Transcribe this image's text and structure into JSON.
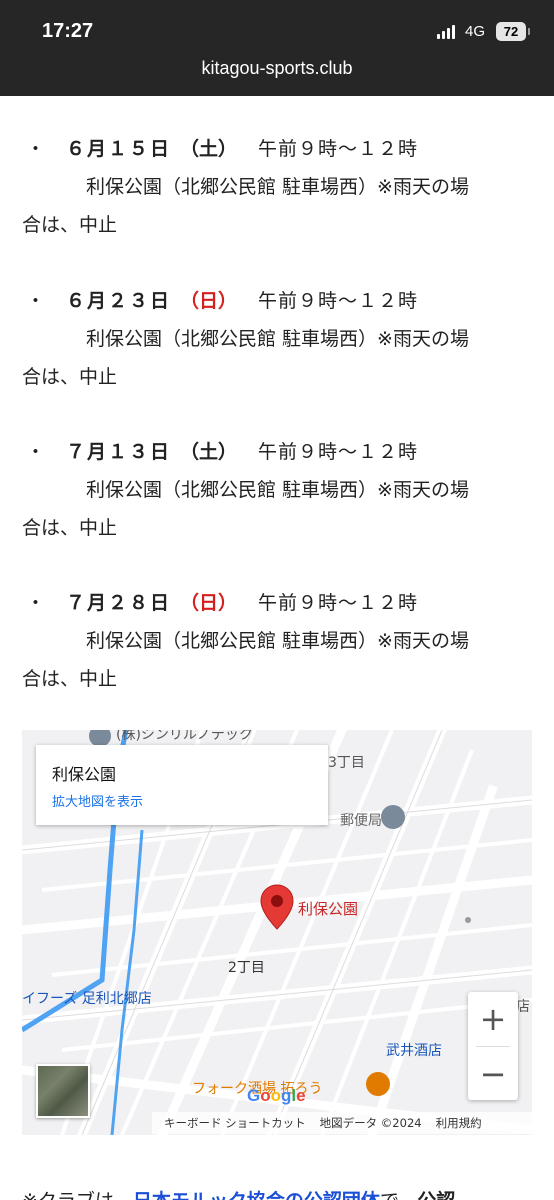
{
  "status_bar": {
    "time": "17:27",
    "network": "4G",
    "battery": "72"
  },
  "browser": {
    "url": "kitagou-sports.club"
  },
  "schedule": [
    {
      "bullet": "・",
      "date": "６月１５日",
      "day_of_week": "（土）",
      "is_sunday": false,
      "time": "午前９時～１２時",
      "place": "利保公園（北郷公民館 駐車場西）※雨天の場",
      "note": "合は、中止"
    },
    {
      "bullet": "・",
      "date": "６月２３日",
      "day_of_week": "（日）",
      "is_sunday": true,
      "time": "午前９時～１２時",
      "place": "利保公園（北郷公民館 駐車場西）※雨天の場",
      "note": "合は、中止"
    },
    {
      "bullet": "・",
      "date": "７月１３日",
      "day_of_week": "（土）",
      "is_sunday": false,
      "time": "午前９時～１２時",
      "place": "利保公園（北郷公民館 駐車場西）※雨天の場",
      "note": "合は、中止"
    },
    {
      "bullet": "・",
      "date": "７月２８日",
      "day_of_week": "（日）",
      "is_sunday": true,
      "time": "午前９時～１２時",
      "place": "利保公園（北郷公民館 駐車場西）※雨天の場",
      "note": "合は、中止"
    }
  ],
  "map": {
    "place_name": "利保公園",
    "view_larger_map": "拡大地図を表示",
    "pin_label": "利保公園",
    "labels": {
      "company": "(株)シンリルノテック",
      "chome3": "3丁目",
      "post_office": "郵便局",
      "chome2": "2丁目",
      "store": "イフーズ 足利北郷店",
      "liquor": "武井酒店",
      "restaurant": "フォーク酒場 拓ろう",
      "edge": "店"
    },
    "zoom_in": "+",
    "zoom_out": "−",
    "google_logo": "Google",
    "attribution": {
      "keyboard_shortcuts": "キーボード ショートカット",
      "map_data": "地図データ ©2024",
      "terms": "利用規約"
    },
    "colors": {
      "pin": "#e53935",
      "water": "#4fa3f2",
      "label_red": "#c62828",
      "label_blue": "#1a56b8",
      "label_orange": "#e07b00"
    }
  },
  "footer_text": {
    "prefix": "※クラブは、",
    "link": "日本モルック協会の公認団体",
    "middle": "で、",
    "bold": "公認"
  }
}
